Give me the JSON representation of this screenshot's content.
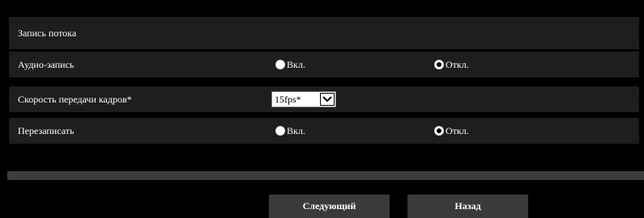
{
  "section": {
    "title": "Запись потока"
  },
  "audio": {
    "label": "Аудио-запись",
    "on_label": "Вкл.",
    "off_label": "Откл.",
    "selected": "off"
  },
  "fps": {
    "label": "Скорость передачи кадров*",
    "value": "15fps*"
  },
  "overwrite": {
    "label": "Перезаписать",
    "on_label": "Вкл.",
    "off_label": "Откл.",
    "selected": "off"
  },
  "buttons": {
    "next": "Следующий",
    "back": "Назад"
  }
}
